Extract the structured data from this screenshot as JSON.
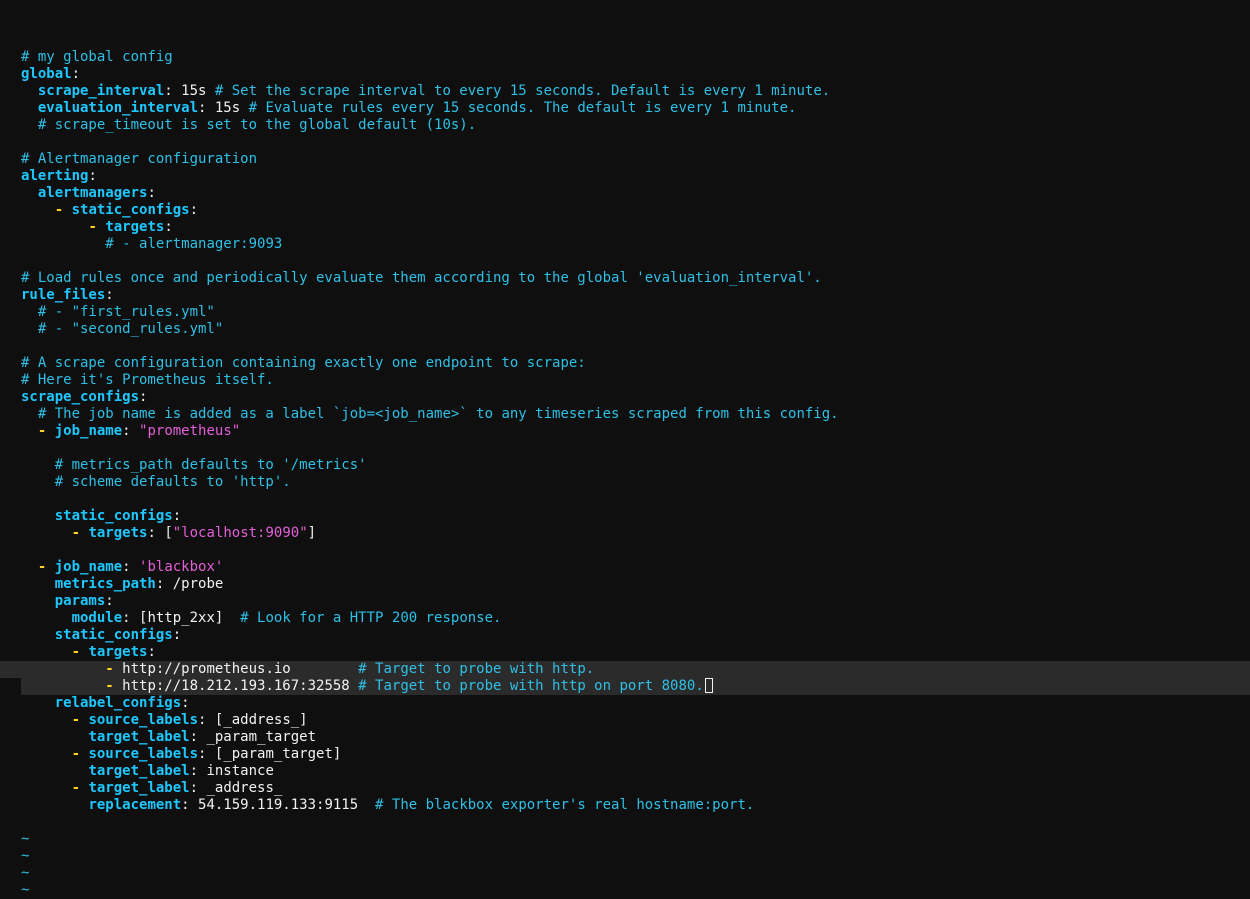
{
  "editor": {
    "colors": {
      "background": "#0f0f0f",
      "key": "#1ec8ff",
      "dash": "#ffd21f",
      "comment": "#2ec0e6",
      "string": "#e45fd8",
      "text": "#f2f2f2",
      "cursorline": "#2b2b2b"
    },
    "cursor": {
      "line": 38
    },
    "lines": [
      {
        "tokens": [
          {
            "t": "c",
            "v": "# my global config"
          }
        ]
      },
      {
        "tokens": [
          {
            "t": "k",
            "v": "global"
          },
          {
            "t": "p",
            "v": ":"
          }
        ]
      },
      {
        "tokens": [
          {
            "t": "p",
            "v": "  "
          },
          {
            "t": "k",
            "v": "scrape_interval"
          },
          {
            "t": "p",
            "v": ": 15s "
          },
          {
            "t": "c",
            "v": "# Set the scrape interval to every 15 seconds. Default is every 1 minute."
          }
        ]
      },
      {
        "tokens": [
          {
            "t": "p",
            "v": "  "
          },
          {
            "t": "k",
            "v": "evaluation_interval"
          },
          {
            "t": "p",
            "v": ": 15s "
          },
          {
            "t": "c",
            "v": "# Evaluate rules every 15 seconds. The default is every 1 minute."
          }
        ]
      },
      {
        "tokens": [
          {
            "t": "p",
            "v": "  "
          },
          {
            "t": "c",
            "v": "# scrape_timeout is set to the global default (10s)."
          }
        ]
      },
      {
        "tokens": []
      },
      {
        "tokens": [
          {
            "t": "c",
            "v": "# Alertmanager configuration"
          }
        ]
      },
      {
        "tokens": [
          {
            "t": "k",
            "v": "alerting"
          },
          {
            "t": "p",
            "v": ":"
          }
        ]
      },
      {
        "tokens": [
          {
            "t": "p",
            "v": "  "
          },
          {
            "t": "k",
            "v": "alertmanagers"
          },
          {
            "t": "p",
            "v": ":"
          }
        ]
      },
      {
        "tokens": [
          {
            "t": "p",
            "v": "    "
          },
          {
            "t": "d",
            "v": "-"
          },
          {
            "t": "p",
            "v": " "
          },
          {
            "t": "k",
            "v": "static_configs"
          },
          {
            "t": "p",
            "v": ":"
          }
        ]
      },
      {
        "tokens": [
          {
            "t": "p",
            "v": "        "
          },
          {
            "t": "d",
            "v": "-"
          },
          {
            "t": "p",
            "v": " "
          },
          {
            "t": "k",
            "v": "targets"
          },
          {
            "t": "p",
            "v": ":"
          }
        ]
      },
      {
        "tokens": [
          {
            "t": "p",
            "v": "          "
          },
          {
            "t": "c",
            "v": "# - alertmanager:9093"
          }
        ]
      },
      {
        "tokens": []
      },
      {
        "tokens": [
          {
            "t": "c",
            "v": "# Load rules once and periodically evaluate them according to the global 'evaluation_interval'."
          }
        ]
      },
      {
        "tokens": [
          {
            "t": "k",
            "v": "rule_files"
          },
          {
            "t": "p",
            "v": ":"
          }
        ]
      },
      {
        "tokens": [
          {
            "t": "p",
            "v": "  "
          },
          {
            "t": "c",
            "v": "# - \"first_rules.yml\""
          }
        ]
      },
      {
        "tokens": [
          {
            "t": "p",
            "v": "  "
          },
          {
            "t": "c",
            "v": "# - \"second_rules.yml\""
          }
        ]
      },
      {
        "tokens": []
      },
      {
        "tokens": [
          {
            "t": "c",
            "v": "# A scrape configuration containing exactly one endpoint to scrape:"
          }
        ]
      },
      {
        "tokens": [
          {
            "t": "c",
            "v": "# Here it's Prometheus itself."
          }
        ]
      },
      {
        "tokens": [
          {
            "t": "k",
            "v": "scrape_configs"
          },
          {
            "t": "p",
            "v": ":"
          }
        ]
      },
      {
        "tokens": [
          {
            "t": "p",
            "v": "  "
          },
          {
            "t": "c",
            "v": "# The job name is added as a label `job=<job_name>` to any timeseries scraped from this config."
          }
        ]
      },
      {
        "tokens": [
          {
            "t": "p",
            "v": "  "
          },
          {
            "t": "d",
            "v": "-"
          },
          {
            "t": "p",
            "v": " "
          },
          {
            "t": "k",
            "v": "job_name"
          },
          {
            "t": "p",
            "v": ": "
          },
          {
            "t": "s",
            "v": "\"prometheus\""
          }
        ]
      },
      {
        "tokens": []
      },
      {
        "tokens": [
          {
            "t": "p",
            "v": "    "
          },
          {
            "t": "c",
            "v": "# metrics_path defaults to '/metrics'"
          }
        ]
      },
      {
        "tokens": [
          {
            "t": "p",
            "v": "    "
          },
          {
            "t": "c",
            "v": "# scheme defaults to 'http'."
          }
        ]
      },
      {
        "tokens": []
      },
      {
        "tokens": [
          {
            "t": "p",
            "v": "    "
          },
          {
            "t": "k",
            "v": "static_configs"
          },
          {
            "t": "p",
            "v": ":"
          }
        ]
      },
      {
        "tokens": [
          {
            "t": "p",
            "v": "      "
          },
          {
            "t": "d",
            "v": "-"
          },
          {
            "t": "p",
            "v": " "
          },
          {
            "t": "k",
            "v": "targets"
          },
          {
            "t": "p",
            "v": ": ["
          },
          {
            "t": "s",
            "v": "\"localhost:9090\""
          },
          {
            "t": "p",
            "v": "]"
          }
        ]
      },
      {
        "tokens": []
      },
      {
        "tokens": [
          {
            "t": "p",
            "v": "  "
          },
          {
            "t": "d",
            "v": "-"
          },
          {
            "t": "p",
            "v": " "
          },
          {
            "t": "k",
            "v": "job_name"
          },
          {
            "t": "p",
            "v": ": "
          },
          {
            "t": "s",
            "v": "'blackbox'"
          }
        ]
      },
      {
        "tokens": [
          {
            "t": "p",
            "v": "    "
          },
          {
            "t": "k",
            "v": "metrics_path"
          },
          {
            "t": "p",
            "v": ": /probe"
          }
        ]
      },
      {
        "tokens": [
          {
            "t": "p",
            "v": "    "
          },
          {
            "t": "k",
            "v": "params"
          },
          {
            "t": "p",
            "v": ":"
          }
        ]
      },
      {
        "tokens": [
          {
            "t": "p",
            "v": "      "
          },
          {
            "t": "k",
            "v": "module"
          },
          {
            "t": "p",
            "v": ": [http_2xx]  "
          },
          {
            "t": "c",
            "v": "# Look for a HTTP 200 response."
          }
        ]
      },
      {
        "tokens": [
          {
            "t": "p",
            "v": "    "
          },
          {
            "t": "k",
            "v": "static_configs"
          },
          {
            "t": "p",
            "v": ":"
          }
        ]
      },
      {
        "tokens": [
          {
            "t": "p",
            "v": "      "
          },
          {
            "t": "d",
            "v": "-"
          },
          {
            "t": "p",
            "v": " "
          },
          {
            "t": "k",
            "v": "targets"
          },
          {
            "t": "p",
            "v": ":"
          }
        ]
      },
      {
        "hl": "full",
        "tokens": [
          {
            "t": "p",
            "v": "          "
          },
          {
            "t": "d",
            "v": "-"
          },
          {
            "t": "p",
            "v": " http://prometheus.io        "
          },
          {
            "t": "c",
            "v": "# Target to probe with http."
          }
        ]
      },
      {
        "hl": "edge",
        "tokens": [
          {
            "t": "p",
            "v": "          "
          },
          {
            "t": "d",
            "v": "-"
          },
          {
            "t": "p",
            "v": " http://18.212.193.167:32558 "
          },
          {
            "t": "c",
            "v": "# Target to probe with http on port 8080."
          }
        ]
      },
      {
        "tokens": [
          {
            "t": "p",
            "v": "    "
          },
          {
            "t": "k",
            "v": "relabel_configs"
          },
          {
            "t": "p",
            "v": ":"
          }
        ]
      },
      {
        "tokens": [
          {
            "t": "p",
            "v": "      "
          },
          {
            "t": "d",
            "v": "-"
          },
          {
            "t": "p",
            "v": " "
          },
          {
            "t": "k",
            "v": "source_labels"
          },
          {
            "t": "p",
            "v": ": [_address_]"
          }
        ]
      },
      {
        "tokens": [
          {
            "t": "p",
            "v": "        "
          },
          {
            "t": "k",
            "v": "target_label"
          },
          {
            "t": "p",
            "v": ": _param_target"
          }
        ]
      },
      {
        "tokens": [
          {
            "t": "p",
            "v": "      "
          },
          {
            "t": "d",
            "v": "-"
          },
          {
            "t": "p",
            "v": " "
          },
          {
            "t": "k",
            "v": "source_labels"
          },
          {
            "t": "p",
            "v": ": [_param_target]"
          }
        ]
      },
      {
        "tokens": [
          {
            "t": "p",
            "v": "        "
          },
          {
            "t": "k",
            "v": "target_label"
          },
          {
            "t": "p",
            "v": ": instance"
          }
        ]
      },
      {
        "tokens": [
          {
            "t": "p",
            "v": "      "
          },
          {
            "t": "d",
            "v": "-"
          },
          {
            "t": "p",
            "v": " "
          },
          {
            "t": "k",
            "v": "target_label"
          },
          {
            "t": "p",
            "v": ": _address_"
          }
        ]
      },
      {
        "tokens": [
          {
            "t": "p",
            "v": "        "
          },
          {
            "t": "k",
            "v": "replacement"
          },
          {
            "t": "p",
            "v": ": 54.159.119.133:9115  "
          },
          {
            "t": "c",
            "v": "# The blackbox exporter's real hostname:port."
          }
        ]
      },
      {
        "tokens": []
      },
      {
        "tokens": [
          {
            "t": "x",
            "v": "~"
          }
        ]
      },
      {
        "tokens": [
          {
            "t": "x",
            "v": "~"
          }
        ]
      },
      {
        "tokens": [
          {
            "t": "x",
            "v": "~"
          }
        ]
      },
      {
        "tokens": [
          {
            "t": "x",
            "v": "~"
          }
        ]
      }
    ]
  }
}
